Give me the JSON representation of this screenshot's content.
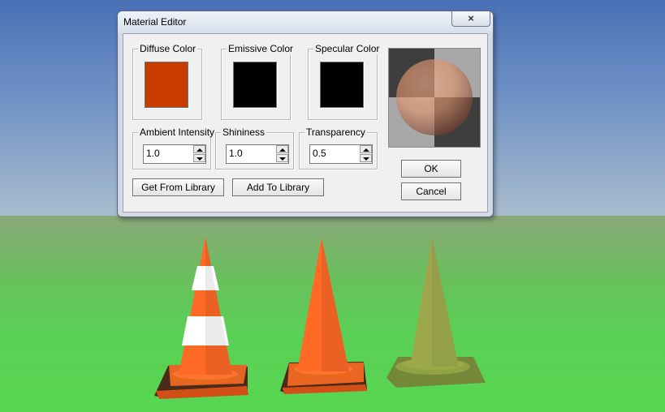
{
  "window": {
    "title": "Material Editor",
    "close_glyph": "×"
  },
  "colors": {
    "diffuse": {
      "label": "Diffuse Color",
      "hex": "#c83c00"
    },
    "emissive": {
      "label": "Emissive Color",
      "hex": "#000000"
    },
    "specular": {
      "label": "Specular Color",
      "hex": "#000000"
    }
  },
  "properties": {
    "ambient": {
      "label": "Ambient Intensity",
      "value": "1.0"
    },
    "shininess": {
      "label": "Shininess",
      "value": "1.0"
    },
    "transparency": {
      "label": "Transparency",
      "value": "0.5"
    }
  },
  "buttons": {
    "get_from_library": "Get From Library",
    "add_to_library": "Add To Library",
    "ok": "OK",
    "cancel": "Cancel"
  },
  "preview": {
    "sphere_color": "#e0926a",
    "checker_dark": "#3e3e3e",
    "checker_light": "#a8a8a8"
  },
  "scene": {
    "cone_colors": [
      "#ff6a26",
      "#ffffff",
      "#a8a24a"
    ]
  }
}
